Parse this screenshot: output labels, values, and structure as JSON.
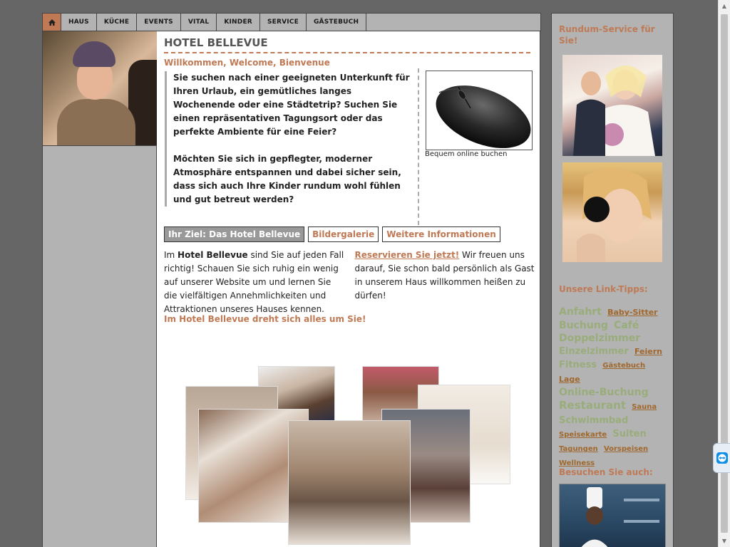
{
  "nav": {
    "home_icon": "home-icon",
    "items": [
      "HAUS",
      "KÜCHE",
      "EVENTS",
      "VITAL",
      "KINDER",
      "SERVICE",
      "GÄSTEBUCH"
    ]
  },
  "main": {
    "title": "HOTEL BELLEVUE",
    "welcome": "Willkommen, Welcome, Bienvenue",
    "intro_p1": "Sie suchen nach einer geeigneten Unterkunft für Ihren Urlaub, ein gemütliches langes Wochenende oder eine Städtetrip? Suchen Sie einen repräsentativen Tagungsort oder das perfekte Ambiente für eine Feier?",
    "intro_p2": "Möchten Sie sich in gepflegter, moderner Atmosphäre entspannen und dabei sicher sein, dass sich auch Ihre Kinder rundum wohl fühlen und gut betreut werden?",
    "mouse_caption": "Bequem online buchen",
    "tabs": [
      "Ihr Ziel: Das Hotel Bellevue",
      "Bildergalerie",
      "Weitere Informationen"
    ],
    "body_1": "Im ",
    "body_bold": "Hotel Bellevue",
    "body_2": " sind Sie auf jeden Fall richtig! Schauen Sie sich ruhig ein wenig auf unserer Website um und lernen Sie die vielfältigen Annehmlichkeiten und Attraktionen unseres Hauses kennen. ",
    "body_link": "Reservieren Sie jetzt!",
    "body_3": " Wir freuen uns darauf, Sie schon bald persönlich als Gast in unserem Haus willkommen heißen zu dürfen!",
    "slogan": "Im Hotel Bellevue dreht sich alles um Sie!"
  },
  "right": {
    "service_heading": "Rundum-Service für Sie!",
    "link_heading": "Unsere Link-Tipps:",
    "visit_heading": "Besuchen Sie auch:",
    "tags": [
      {
        "text": "Anfahrt",
        "size": "big"
      },
      {
        "text": "Baby-Sitter",
        "size": "sm"
      },
      {
        "text": "Buchung",
        "size": "big"
      },
      {
        "text": "Café",
        "size": "big"
      },
      {
        "text": "Doppelzimmer",
        "size": "big"
      },
      {
        "text": "Einzelzimmer",
        "size": "med"
      },
      {
        "text": "Feiern",
        "size": "sm"
      },
      {
        "text": "Fitness",
        "size": "med"
      },
      {
        "text": "Gästebuch",
        "size": "xs"
      },
      {
        "text": "Lage",
        "size": "sm"
      },
      {
        "text": "Online-Buchung",
        "size": "big"
      },
      {
        "text": "Restaurant",
        "size": "xl"
      },
      {
        "text": "Sauna",
        "size": "xs"
      },
      {
        "text": "Schwimmbad",
        "size": "med"
      },
      {
        "text": "Speisekarte",
        "size": "xs"
      },
      {
        "text": "Suiten",
        "size": "med"
      },
      {
        "text": "Tagungen",
        "size": "xs"
      },
      {
        "text": "Vorspeisen",
        "size": "xs"
      },
      {
        "text": "Wellness",
        "size": "xs"
      }
    ]
  },
  "colors": {
    "accent": "#bf7a55",
    "tag_green": "#99ad7a",
    "tag_brown": "#a0682c",
    "sidebar_gray": "#b3b3b3",
    "page_gray": "#666666"
  }
}
